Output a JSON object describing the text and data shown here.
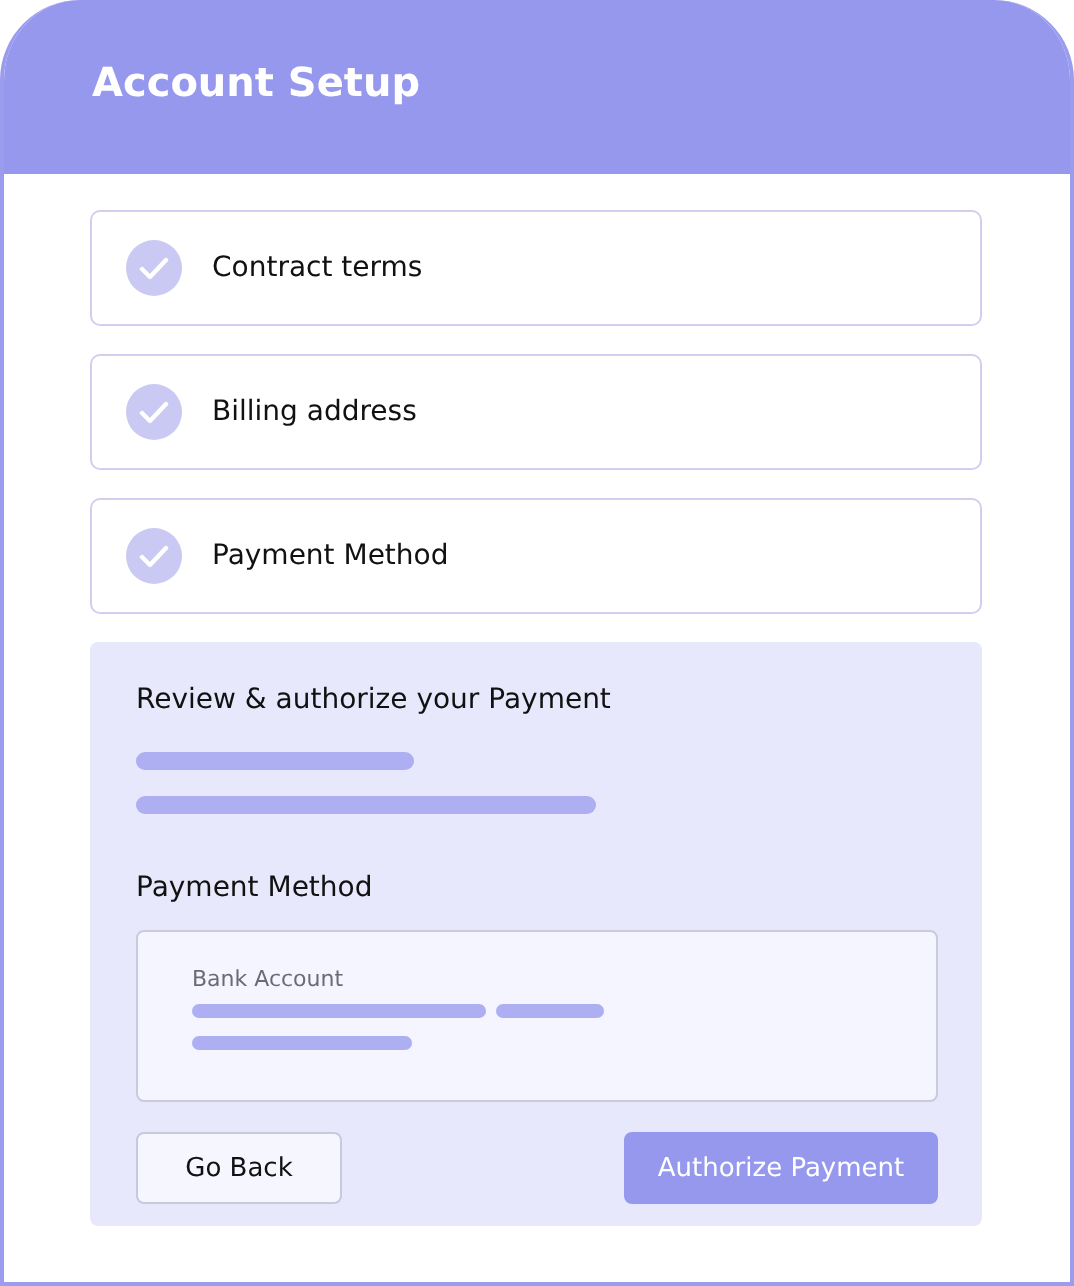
{
  "window": {
    "title": "Account Setup"
  },
  "steps": [
    {
      "label": "Contract terms",
      "checked": true
    },
    {
      "label": "Billing address",
      "checked": true
    },
    {
      "label": "Payment Method",
      "checked": true
    }
  ],
  "review": {
    "title": "Review & authorize your Payment",
    "method_heading": "Payment Method",
    "method_label": "Bank Account"
  },
  "buttons": [
    {
      "label": "Go Back",
      "kind": "secondary"
    },
    {
      "label": "Authorize Payment",
      "kind": "primary"
    }
  ]
}
